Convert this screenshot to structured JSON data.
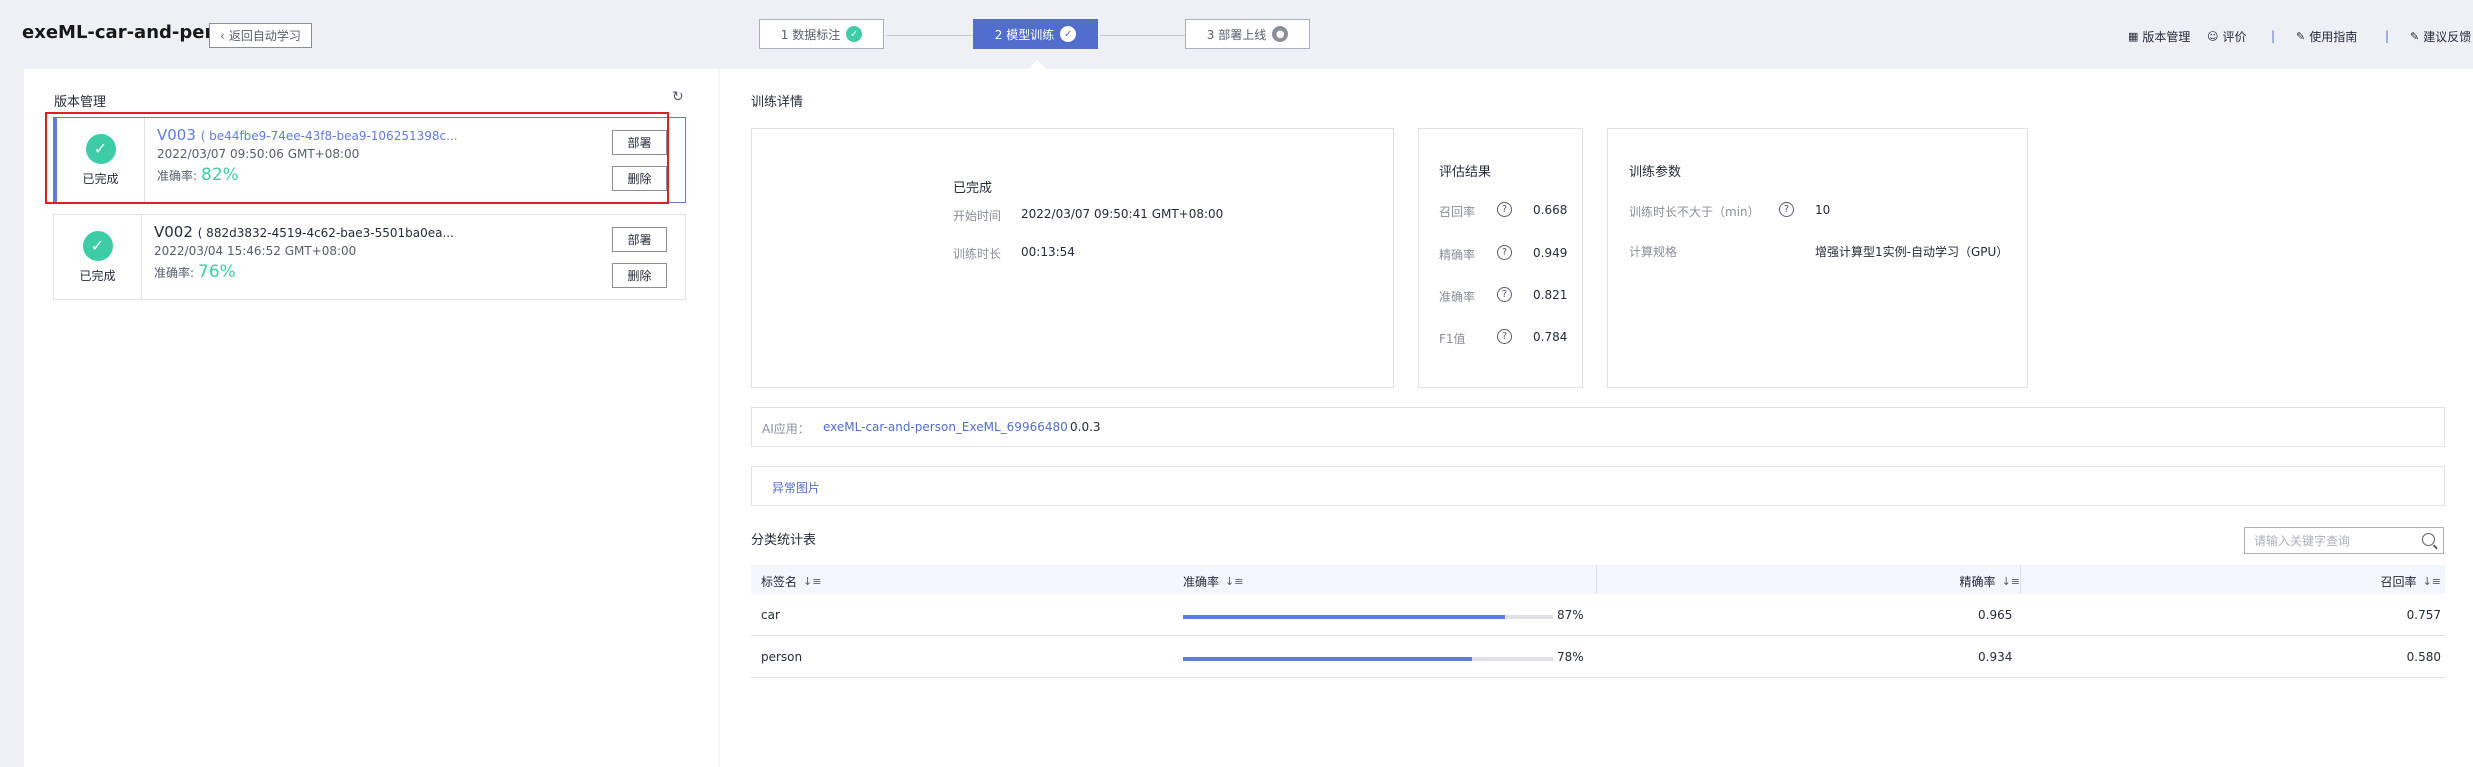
{
  "header": {
    "app_title": "exeML-car-and-person",
    "back_label": "返回自动学习",
    "steps": [
      {
        "label": "1 数据标注",
        "state": "done"
      },
      {
        "label": "2 模型训练",
        "state": "active"
      },
      {
        "label": "3 部署上线",
        "state": "pending"
      }
    ],
    "links": {
      "version_mgmt": "版本管理",
      "rating": "评价",
      "guide": "使用指南",
      "feedback": "建议反馈",
      "separator": "|"
    }
  },
  "versions": {
    "title": "版本管理",
    "items": [
      {
        "name": "V003",
        "id": "( be44fbe9-74ee-43f8-bea9-106251398c...",
        "status": "已完成",
        "date": "2022/03/07 09:50:06 GMT+08:00",
        "acc_label": "准确率:",
        "acc": "82%",
        "deploy": "部署",
        "delete": "删除"
      },
      {
        "name": "V002",
        "id": "( 882d3832-4519-4c62-bae3-5501ba0ea...",
        "status": "已完成",
        "date": "2022/03/04 15:46:52 GMT+08:00",
        "acc_label": "准确率:",
        "acc": "76%",
        "deploy": "部署",
        "delete": "删除"
      }
    ]
  },
  "details": {
    "title": "训练详情",
    "status": "已完成",
    "start_label": "开始时间",
    "start_value": "2022/03/07 09:50:41 GMT+08:00",
    "duration_label": "训练时长",
    "duration_value": "00:13:54"
  },
  "eval": {
    "title": "评估结果",
    "rows": [
      {
        "label": "召回率",
        "value": "0.668"
      },
      {
        "label": "精确率",
        "value": "0.949"
      },
      {
        "label": "准确率",
        "value": "0.821"
      },
      {
        "label": "F1值",
        "value": "0.784"
      }
    ]
  },
  "params": {
    "title": "训练参数",
    "time_label": "训练时长不大于（min）",
    "time_value": "10",
    "spec_label": "计算规格",
    "spec_value": "增强计算型1实例-自动学习（GPU）"
  },
  "ai_app": {
    "label": "AI应用：",
    "link": "exeML-car-and-person_ExeML_69966480",
    "version": "0.0.3"
  },
  "abnormal_label": "异常图片",
  "stats": {
    "title": "分类统计表",
    "search_placeholder": "请输入关键字查询",
    "columns": [
      "标签名",
      "准确率",
      "精确率",
      "召回率"
    ],
    "rows": [
      {
        "name": "car",
        "accuracy": "87%",
        "accuracy_frac": 0.87,
        "precision": "0.965",
        "recall": "0.757"
      },
      {
        "name": "person",
        "accuracy": "78%",
        "accuracy_frac": 0.78,
        "precision": "0.934",
        "recall": "0.580"
      }
    ]
  }
}
